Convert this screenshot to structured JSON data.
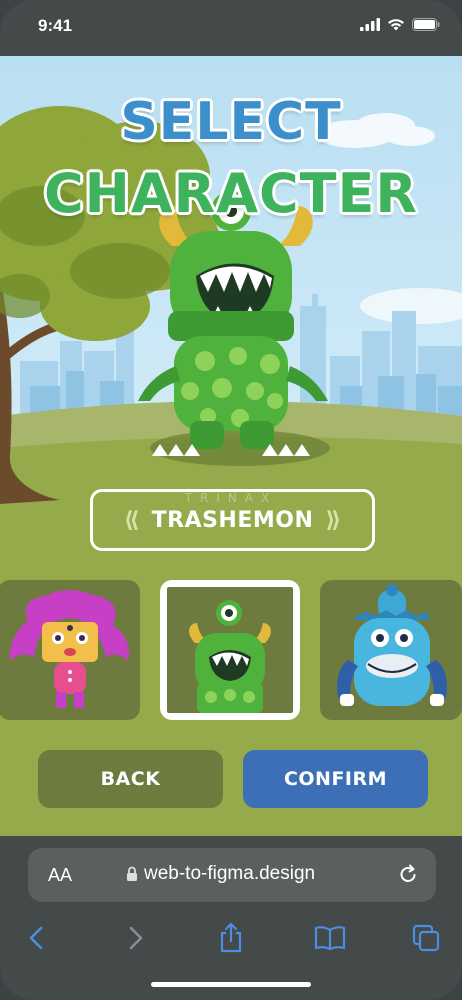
{
  "status_bar": {
    "time": "9:41"
  },
  "game": {
    "title_line1": "SELECT",
    "title_line2": "CHARACTER",
    "selected_name": "TRASHEMON",
    "prev_arrow": "⟪",
    "next_arrow": "⟫",
    "watermark": "TRINAX",
    "characters": [
      {
        "name": "purple-haired-girl",
        "selected": false
      },
      {
        "name": "trashemon",
        "selected": true
      },
      {
        "name": "blue-furry-monster",
        "selected": false
      }
    ],
    "back_label": "BACK",
    "confirm_label": "CONFIRM",
    "colors": {
      "back": "#6d7b3e",
      "confirm": "#3c6fb6",
      "grass": "#95aa4b",
      "title_blue": "#3c8fcb",
      "title_green": "#3eb25c"
    }
  },
  "browser": {
    "text_size_label": "AA",
    "url": "web-to-figma.design",
    "toolbar_icons": [
      "back-arrow-icon",
      "forward-arrow-icon",
      "share-icon",
      "bookmarks-icon",
      "tabs-icon"
    ]
  }
}
